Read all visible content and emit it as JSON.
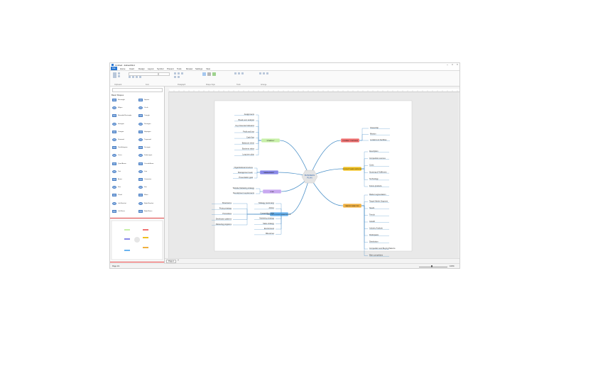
{
  "window": {
    "title": "Untitled - EdrawMind"
  },
  "menu": [
    "File",
    "Home",
    "Insert",
    "Design",
    "Layout",
    "Symbol",
    "Present",
    "Tools",
    "Review",
    "Settings",
    "View"
  ],
  "ribbon": {
    "groups": [
      "Clipboard",
      "Font",
      "Paragraph",
      "Shape Style",
      "Tools",
      "Arrange"
    ]
  },
  "library": {
    "search_placeholder": "Search",
    "header": "Basic Shapes",
    "shapes": [
      "Rectangle",
      "Square",
      "Ellipse",
      "Circle",
      "Rounded Rectangle",
      "Triangle",
      "Hexagon",
      "Pentagon",
      "Octagon",
      "Heptagon",
      "Diamond",
      "Trapezoid",
      "Parallelogram",
      "Decagon",
      "Cross",
      "Dodecagon",
      "Quad Arrow",
      "Curved Arrow",
      "Text",
      "Line",
      "Arrow",
      "Connector",
      "Star",
      "Sun",
      "Cloud",
      "Moon",
      "Left Bracket",
      "Right Bracket",
      "Left Brace",
      "Right Brace"
    ]
  },
  "pages": {
    "tab": "Page-1",
    "add": "+"
  },
  "status": {
    "page": "Page 1/1",
    "zoom": "100%"
  },
  "mindmap": {
    "center": "BUSINESS\nPLAN",
    "branches": [
      {
        "label": "STRATEGY",
        "color": "#c8f0a8",
        "side": "left",
        "leaves": [
          "Assignments",
          "Break even analysis",
          "Key Financial Indicators",
          "Profit and loss",
          "Cash flow",
          "Balanced sheet",
          "Business ratios",
          "Long term plan"
        ]
      },
      {
        "label": "MANAGEMENT",
        "color": "#8888e8",
        "side": "left",
        "leaves": [
          "Organizational structure",
          "Management team",
          "Presentation goal"
        ]
      },
      {
        "label": "GOAL",
        "color": "#c8a8f0",
        "side": "left",
        "leaves": [
          "Website Marketing strategy",
          "Development requirements"
        ]
      },
      {
        "label": "IMPLEMENT & IMPLEMENTATION",
        "color": "#6ab4f0",
        "side": "left",
        "leaves": [
          "Showrooms",
          "Pricing strategy",
          "Promotions",
          "Distribution patterns",
          "Marketing programs",
          "Strategy (summary)",
          "Advice",
          "Competitive edge",
          "Marketing strategy",
          "Sales strategy",
          "Environment",
          "Milestones"
        ]
      },
      {
        "label": "COMPANY OVERVIEW",
        "color": "#f07070",
        "side": "right",
        "leaves": [
          "Ownership",
          "Mission",
          "Locations & Facilities"
        ]
      },
      {
        "label": "PRODUCTS AND SERVICES",
        "color": "#f0c020",
        "side": "right",
        "leaves": [
          "Description",
          "Competitors sources",
          "Costs",
          "Sourcing & Fulfillment",
          "Technology",
          "Future products"
        ]
      },
      {
        "label": "MARKET ANALYSIS",
        "color": "#f0b040",
        "side": "right",
        "leaves": [
          "Market segmentation",
          "Target Market Segment",
          "Needs",
          "Trends",
          "Growth",
          "Industry Analysis",
          "Participants",
          "Distribution",
          "Competition and Buying Patterns",
          "Main competitors"
        ]
      }
    ]
  }
}
